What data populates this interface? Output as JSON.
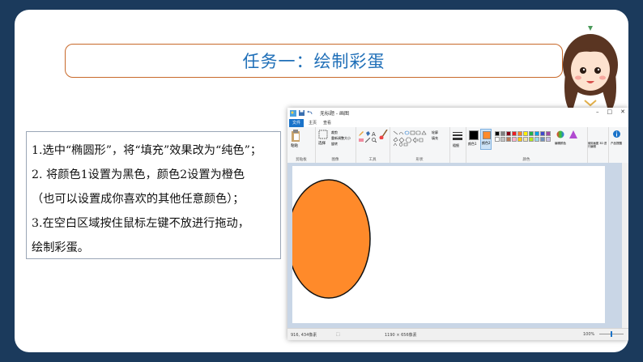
{
  "slide": {
    "title": "任务一：绘制彩蛋",
    "instructions": [
      "1.选中“椭圆形”，将“填充”效果改为“纯色”；",
      "2. 将颜色1设置为黑色，颜色2设置为橙色",
      "（也可以设置成你喜欢的其他任意颜色）；",
      "3.在空白区域按住鼠标左键不放进行拖动，",
      "绘制彩蛋。"
    ]
  },
  "paint": {
    "window_title": "无标题 - 画图",
    "tabs": {
      "file": "文件",
      "home": "主页",
      "view": "查看"
    },
    "ribbon_groups": {
      "clipboard": "剪贴板",
      "image": "图像",
      "tools": "工具",
      "shapes": "形状",
      "colors": "颜色"
    },
    "buttons": {
      "paste": "粘贴",
      "select": "选择",
      "crop": "裁剪",
      "resize": "重新调整大小",
      "rotate": "旋转",
      "outline": "轮廓",
      "fill": "填充",
      "size": "粗细",
      "color1": "颜色1",
      "color2": "颜色2",
      "edit_colors": "编辑颜色",
      "paint3d": "使用画图 3D 进行编辑",
      "product_alert": "产品提醒"
    },
    "status": {
      "cursor": "916, 434像素",
      "canvas_size": "1190 × 656像素",
      "zoom": "100%"
    },
    "colors": {
      "ellipse_fill": "#ff8a2a",
      "ellipse_stroke": "#111111",
      "color1": "#000000",
      "color2": "#ff8a2a"
    },
    "palette": [
      "#000000",
      "#7f7f7f",
      "#880015",
      "#ed1c24",
      "#ff7f27",
      "#fff200",
      "#22b14c",
      "#00a2e8",
      "#3f48cc",
      "#a349a4",
      "#ffffff",
      "#c3c3c3",
      "#b97a57",
      "#ffaec9",
      "#ffc90e",
      "#efe4b0",
      "#b5e61d",
      "#99d9ea",
      "#7092be",
      "#c8bfe7"
    ]
  }
}
